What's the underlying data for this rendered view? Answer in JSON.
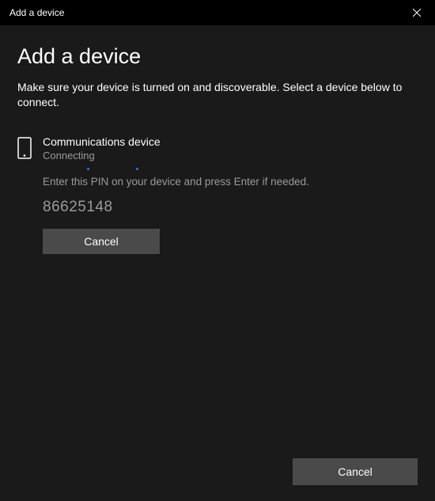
{
  "titlebar": {
    "title": "Add a device"
  },
  "main": {
    "heading": "Add a device",
    "subtext": "Make sure your device is turned on and discoverable. Select a device below to connect."
  },
  "device": {
    "name": "Communications device",
    "status": "Connecting",
    "pin_instruction": "Enter this PIN on your device and press Enter if needed.",
    "pin_code": "86625148",
    "cancel_label": "Cancel"
  },
  "footer": {
    "cancel_label": "Cancel"
  }
}
